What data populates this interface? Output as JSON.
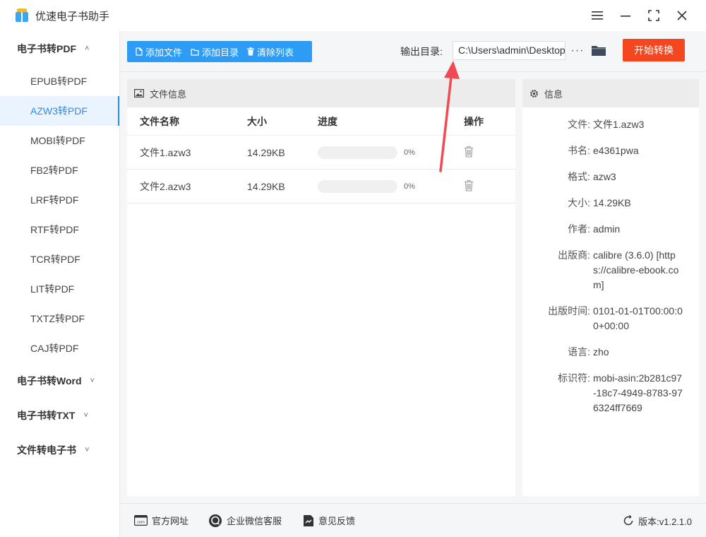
{
  "app": {
    "title": "优速电子书助手"
  },
  "sidebar": {
    "groups": [
      {
        "label": "电子书转PDF",
        "expanded": true,
        "items": [
          "EPUB转PDF",
          "AZW3转PDF",
          "MOBI转PDF",
          "FB2转PDF",
          "LRF转PDF",
          "RTF转PDF",
          "TCR转PDF",
          "LIT转PDF",
          "TXTZ转PDF",
          "CAJ转PDF"
        ],
        "active_item": "AZW3转PDF"
      },
      {
        "label": "电子书转Word",
        "expanded": false
      },
      {
        "label": "电子书转TXT",
        "expanded": false
      },
      {
        "label": "文件转电子书",
        "expanded": false
      }
    ]
  },
  "toolbar": {
    "add_file": "添加文件",
    "add_folder": "添加目录",
    "clear_list": "清除列表",
    "output_label": "输出目录:",
    "output_path": "C:\\Users\\admin\\Desktop",
    "more": "···",
    "start": "开始转换"
  },
  "file_panel": {
    "title": "文件信息",
    "columns": [
      "文件名称",
      "大小",
      "进度",
      "操作"
    ],
    "rows": [
      {
        "name": "文件1.azw3",
        "size": "14.29KB",
        "progress": "0%",
        "progress_value": 0
      },
      {
        "name": "文件2.azw3",
        "size": "14.29KB",
        "progress": "0%",
        "progress_value": 0
      }
    ]
  },
  "info_panel": {
    "title": "信息",
    "rows": [
      {
        "key": "文件:",
        "value": "文件1.azw3"
      },
      {
        "key": "书名:",
        "value": "e4361pwa"
      },
      {
        "key": "格式:",
        "value": "azw3"
      },
      {
        "key": "大小:",
        "value": "14.29KB"
      },
      {
        "key": "作者:",
        "value": "admin"
      },
      {
        "key": "出版商:",
        "value": "calibre (3.6.0) [https://calibre-ebook.com]"
      },
      {
        "key": "出版时间:",
        "value": "0101-01-01T00:00:00+00:00"
      },
      {
        "key": "语言:",
        "value": "zho"
      },
      {
        "key": "标识符:",
        "value": "mobi-asin:2b281c97-18c7-4949-8783-976324ff7669"
      }
    ]
  },
  "statusbar": {
    "website": "官方网址",
    "wechat": "企业微信客服",
    "feedback": "意见反馈",
    "version": "版本:v1.2.1.0"
  },
  "colors": {
    "accent": "#2e9cf4",
    "start_button": "#f4471f",
    "annotation_arrow": "#f04a52",
    "active_sidebar_bg": "#e9f4fe"
  }
}
